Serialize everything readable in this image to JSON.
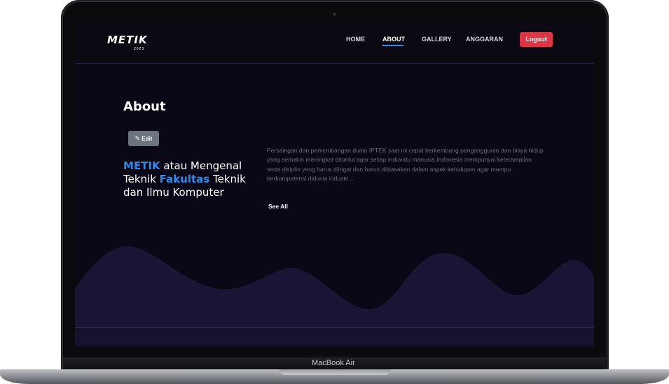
{
  "device": {
    "model_label": "MacBook Air"
  },
  "navbar": {
    "logo": "METIK",
    "logo_sub": "2023",
    "items": [
      {
        "label": "HOME"
      },
      {
        "label": "ABOUT"
      },
      {
        "label": "GALLERY"
      },
      {
        "label": "ANGGARAN"
      }
    ],
    "active_item": "ABOUT",
    "logout_label": "Logout"
  },
  "about": {
    "title": "About",
    "edit_label": "Edit",
    "heading": {
      "part1": "METIK",
      "part2": " atau Mengenal Teknik ",
      "part3": "Fakultas",
      "part4": " Teknik dan Ilmu Komputer"
    },
    "description": "Persaingan dan perkembangan dunia IPTEK saat ini cepat berkembang pengangguran dan biaya hidup yang semakin meningkat dituntut agar setiap induvidu manusia Indonesia mempunyai keterampilan serta disiplin yang harus diingat dan harus dibiasakan dalam aspek kehidupan agar mampu berkompetensi didunia industri ...",
    "see_all_label": "See All"
  },
  "colors": {
    "background": "#0a0817",
    "accent": "#2f8bea",
    "logout": "#dc3545",
    "edit": "#6c757d",
    "wave": "#1a1535"
  }
}
